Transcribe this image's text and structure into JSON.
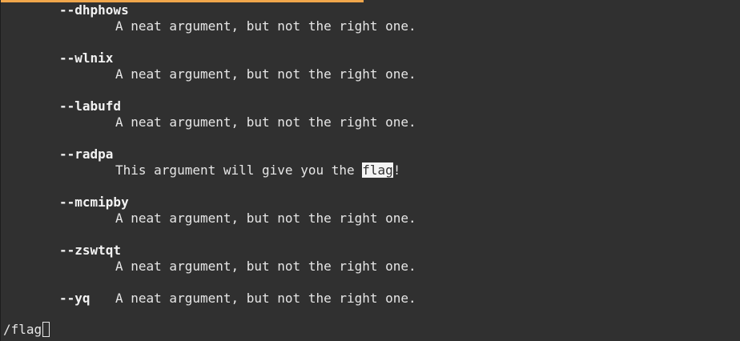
{
  "accent_color": "#f0a64b",
  "progress_fraction": 0.49,
  "entries": [
    {
      "flag": "--dhphows",
      "desc": "A neat argument, but not the right one."
    },
    {
      "flag": "--wlnix",
      "desc": "A neat argument, but not the right one."
    },
    {
      "flag": "--labufd",
      "desc": "A neat argument, but not the right one."
    },
    {
      "flag": "--radpa",
      "desc_before": "This argument will give you the ",
      "desc_match": "flag",
      "desc_after": "!"
    },
    {
      "flag": "--mcmipby",
      "desc": "A neat argument, but not the right one."
    },
    {
      "flag": "--zswtqt",
      "desc": "A neat argument, but not the right one."
    },
    {
      "flag": "--yq",
      "desc": "A neat argument, but not the right one."
    }
  ],
  "command_line": "/flag"
}
